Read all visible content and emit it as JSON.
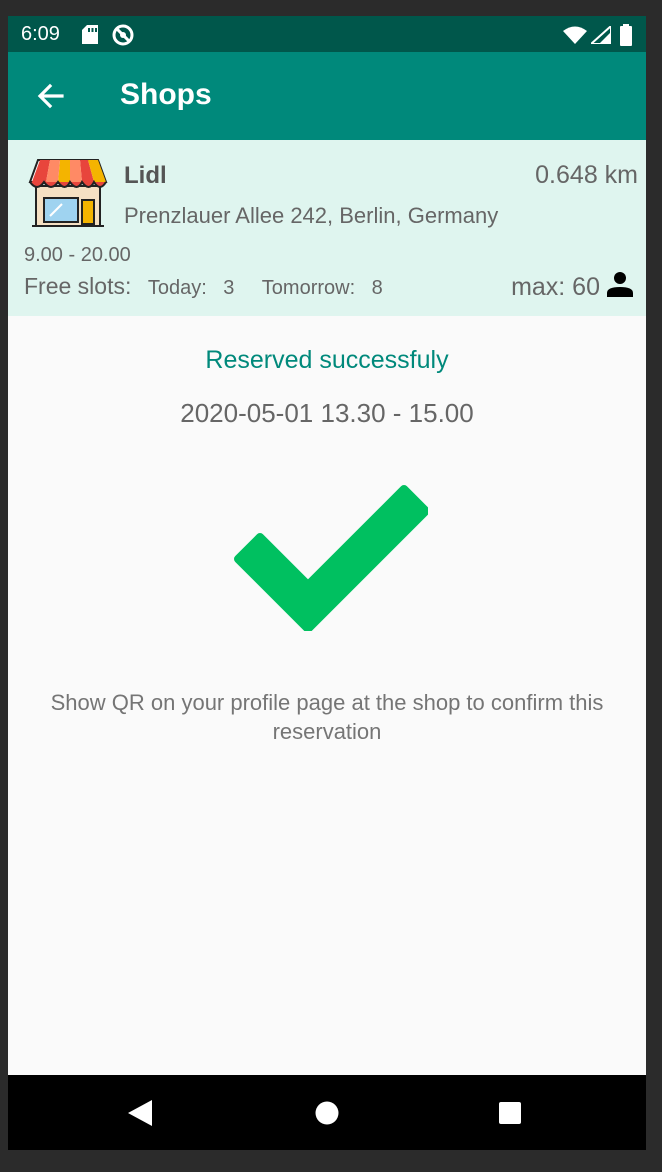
{
  "status_bar": {
    "time": "6:09"
  },
  "app_bar": {
    "title": "Shops"
  },
  "shop": {
    "name": "Lidl",
    "distance": "0.648 km",
    "address": "Prenzlauer Allee 242, Berlin, Germany",
    "hours": "9.00 - 20.00",
    "free_slots_label": "Free slots:",
    "today_label": "Today:",
    "today_value": "3",
    "tomorrow_label": "Tomorrow:",
    "tomorrow_value": "8",
    "max_label": "max: 60"
  },
  "confirmation": {
    "status": "Reserved successfuly",
    "slot": "2020-05-01 13.30 - 15.00",
    "message": "Show QR on your profile page at the shop to confirm this reservation"
  },
  "colors": {
    "status_bar": "#00574b",
    "app_bar": "#00897b",
    "card_bg": "#dff5ef",
    "accent_text": "#00897b",
    "check": "#00c060"
  }
}
